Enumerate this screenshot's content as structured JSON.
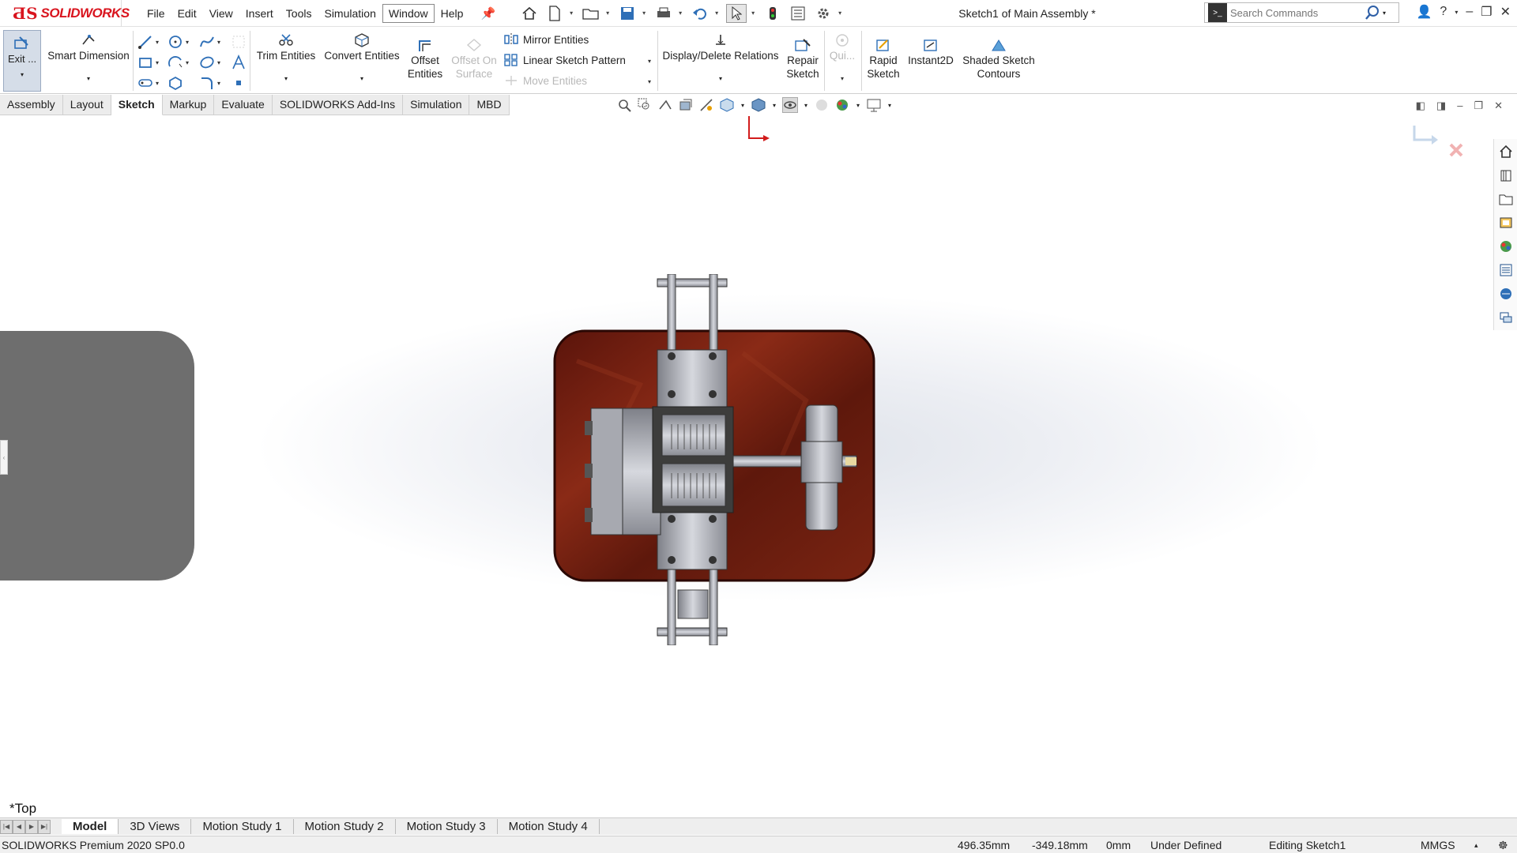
{
  "app": {
    "logo_text": "SOLIDWORKS",
    "document_title": "Sketch1 of Main Assembly *"
  },
  "menu": [
    "File",
    "Edit",
    "View",
    "Insert",
    "Tools",
    "Simulation",
    "Window",
    "Help"
  ],
  "search": {
    "placeholder": "Search Commands"
  },
  "toolbar": {
    "exit_sketch": "Exit ...",
    "smart_dimension": "Smart Dimension",
    "trim_entities": "Trim Entities",
    "convert_entities": "Convert Entities",
    "offset_entities_l1": "Offset",
    "offset_entities_l2": "Entities",
    "offset_on_surface_l1": "Offset On",
    "offset_on_surface_l2": "Surface",
    "mirror_entities": "Mirror Entities",
    "linear_sketch_pattern": "Linear Sketch Pattern",
    "move_entities": "Move Entities",
    "display_delete_relations": "Display/Delete Relations",
    "repair_sketch_l1": "Repair",
    "repair_sketch_l2": "Sketch",
    "quick_snaps": "Qui...",
    "rapid_sketch_l1": "Rapid",
    "rapid_sketch_l2": "Sketch",
    "instant2d": "Instant2D",
    "shaded_contours_l1": "Shaded Sketch",
    "shaded_contours_l2": "Contours"
  },
  "tabs": [
    "Assembly",
    "Layout",
    "Sketch",
    "Markup",
    "Evaluate",
    "SOLIDWORKS Add-Ins",
    "Simulation",
    "MBD"
  ],
  "viewport": {
    "view_label": "*Top"
  },
  "bottom_tabs": [
    "Model",
    "3D Views",
    "Motion Study 1",
    "Motion Study 2",
    "Motion Study 3",
    "Motion Study 4"
  ],
  "status": {
    "product": "SOLIDWORKS Premium 2020 SP0.0",
    "x": "496.35mm",
    "y": "-349.18mm",
    "z": "0mm",
    "state": "Under Defined",
    "editing": "Editing Sketch1",
    "units": "MMGS"
  },
  "colors": {
    "brand_red": "#d9141e",
    "wood_base": "#6b1a0e",
    "metal": "#9a9ca3"
  }
}
